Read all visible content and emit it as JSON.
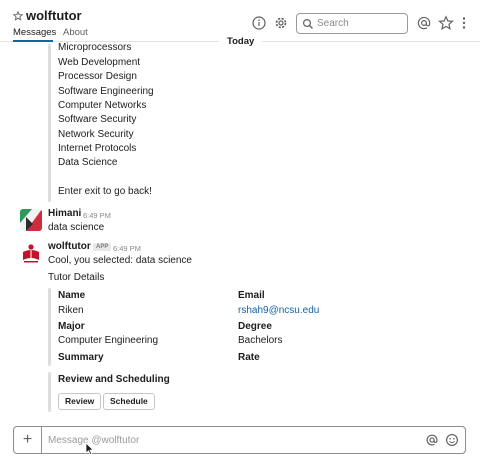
{
  "header": {
    "channel_name": "wolftutor",
    "tabs": [
      "Messages",
      "About"
    ],
    "search_placeholder": "Search"
  },
  "divider": {
    "label": "Today"
  },
  "menu_list": {
    "items": [
      "Microprocessors",
      "Web Development",
      "Processor Design",
      "Software Engineering",
      "Computer Networks",
      "Software Security",
      "Network Security",
      "Internet Protocols",
      "Data Science"
    ],
    "exit_hint": "Enter exit to go back!"
  },
  "messages": [
    {
      "author": "Himani",
      "time": "6:49 PM",
      "text": "data science"
    },
    {
      "author": "wolftutor",
      "badge": "APP",
      "time": "6:49 PM",
      "text": "Cool, you selected: data science"
    }
  ],
  "tutor": {
    "section_title": "Tutor Details",
    "name_label": "Name",
    "name_value": "Riken",
    "email_label": "Email",
    "email_value": "rshah9@ncsu.edu",
    "major_label": "Major",
    "major_value": "Computer Engineering",
    "degree_label": "Degree",
    "degree_value": "Bachelors",
    "summary_label": "Summary",
    "rate_label": "Rate"
  },
  "scheduling": {
    "title": "Review and Scheduling",
    "review_label": "Review",
    "schedule_label": "Schedule"
  },
  "composer": {
    "placeholder": "Message @wolftutor"
  },
  "colors": {
    "link": "#1264a3",
    "accent_tab": "#1264a3",
    "himani_avatar_red": "#d12c3e",
    "himani_avatar_green": "#2f9a5b",
    "wolftutor_avatar_red": "#c8102e"
  }
}
